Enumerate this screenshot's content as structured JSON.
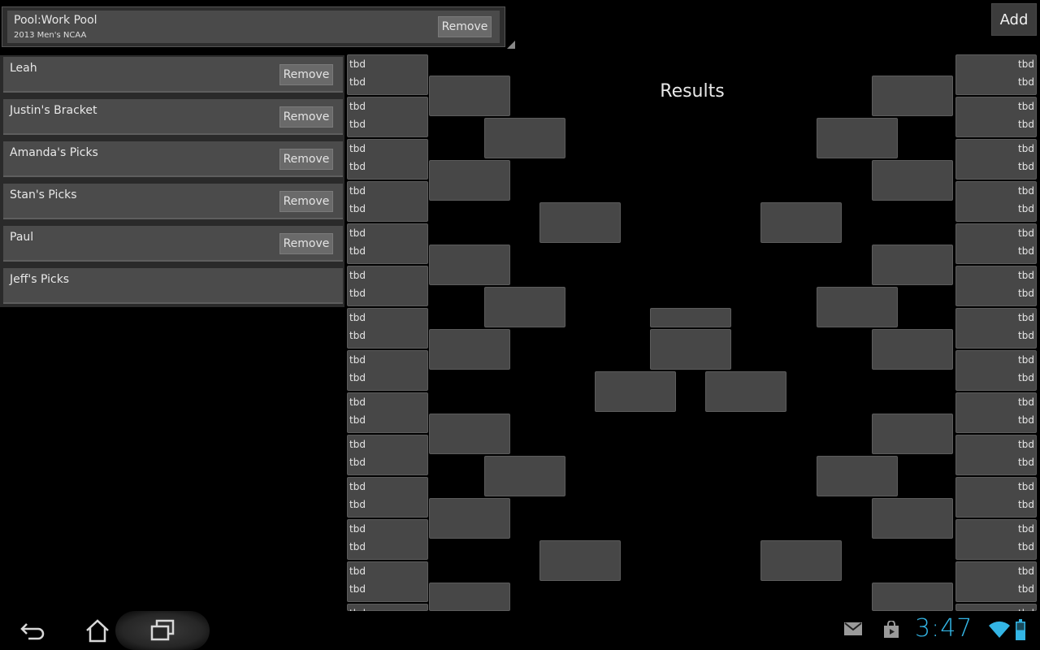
{
  "pool": {
    "title": "Pool:Work Pool",
    "subtitle": "2013 Men's NCAA",
    "remove_label": "Remove"
  },
  "brackets": [
    {
      "name": "Leah",
      "remove_label": "Remove"
    },
    {
      "name": "Justin's Bracket",
      "remove_label": "Remove"
    },
    {
      "name": "Amanda's Picks",
      "remove_label": "Remove"
    },
    {
      "name": "Stan's Picks",
      "remove_label": "Remove"
    },
    {
      "name": "Paul",
      "remove_label": "Remove"
    },
    {
      "name": "Jeff's Picks",
      "remove_label": ""
    }
  ],
  "add_label": "Add",
  "results_title": "Results",
  "slot_text": "tbd",
  "status": {
    "time": "3:47"
  },
  "icons": {
    "back": "back-icon",
    "home": "home-icon",
    "recent": "recent-apps-icon",
    "gmail": "gmail-icon",
    "store": "play-store-icon",
    "wifi": "wifi-icon",
    "battery": "battery-icon"
  },
  "colors": {
    "accent": "#33b5e5",
    "box": "#474747",
    "background": "#000000"
  }
}
